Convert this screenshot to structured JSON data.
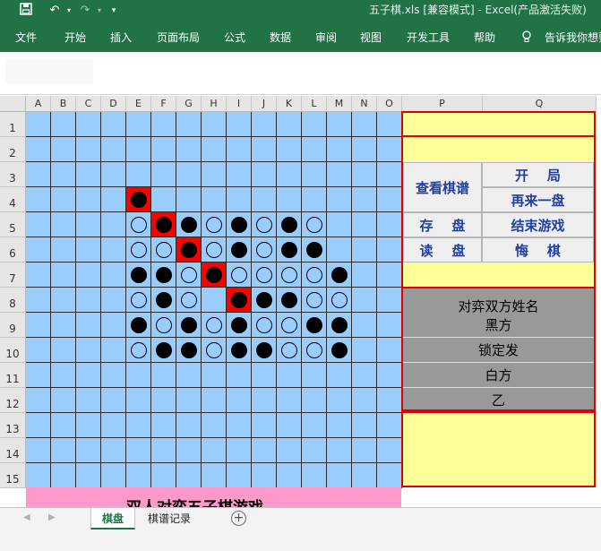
{
  "titlebar": {
    "title": "五子棋.xls  [兼容模式]  -  Excel(产品激活失败)",
    "save_icon": "save-icon",
    "undo_icon": "undo-icon",
    "redo_icon": "redo-icon",
    "customize_icon": "customize-quick-access-icon"
  },
  "ribbon": {
    "tabs": [
      "文件",
      "开始",
      "插入",
      "页面布局",
      "公式",
      "数据",
      "审阅",
      "视图",
      "开发工具",
      "帮助"
    ],
    "tell_me": "告诉我你想要"
  },
  "columns": [
    "A",
    "B",
    "C",
    "D",
    "E",
    "F",
    "G",
    "H",
    "I",
    "J",
    "K",
    "L",
    "M",
    "N",
    "O",
    "P",
    "Q"
  ],
  "rows": [
    "1",
    "2",
    "3",
    "4",
    "5",
    "6",
    "7",
    "8",
    "9",
    "10",
    "11",
    "12",
    "13",
    "14",
    "15"
  ],
  "board": {
    "cell_color": "#99ccff",
    "highlight_color": "#ff0000",
    "stones": [
      {
        "row": 4,
        "col": "E",
        "color": "black",
        "highlight": true
      },
      {
        "row": 5,
        "col": "E",
        "color": "white"
      },
      {
        "row": 5,
        "col": "F",
        "color": "black",
        "highlight": true
      },
      {
        "row": 5,
        "col": "G",
        "color": "black"
      },
      {
        "row": 5,
        "col": "H",
        "color": "white"
      },
      {
        "row": 5,
        "col": "I",
        "color": "black"
      },
      {
        "row": 5,
        "col": "J",
        "color": "white"
      },
      {
        "row": 5,
        "col": "K",
        "color": "black"
      },
      {
        "row": 5,
        "col": "L",
        "color": "white"
      },
      {
        "row": 6,
        "col": "E",
        "color": "white"
      },
      {
        "row": 6,
        "col": "F",
        "color": "white"
      },
      {
        "row": 6,
        "col": "G",
        "color": "black",
        "highlight": true
      },
      {
        "row": 6,
        "col": "H",
        "color": "white"
      },
      {
        "row": 6,
        "col": "I",
        "color": "black"
      },
      {
        "row": 6,
        "col": "J",
        "color": "white"
      },
      {
        "row": 6,
        "col": "K",
        "color": "black"
      },
      {
        "row": 6,
        "col": "L",
        "color": "black"
      },
      {
        "row": 7,
        "col": "E",
        "color": "black"
      },
      {
        "row": 7,
        "col": "F",
        "color": "black"
      },
      {
        "row": 7,
        "col": "G",
        "color": "white"
      },
      {
        "row": 7,
        "col": "H",
        "color": "black",
        "highlight": true
      },
      {
        "row": 7,
        "col": "I",
        "color": "white"
      },
      {
        "row": 7,
        "col": "J",
        "color": "white"
      },
      {
        "row": 7,
        "col": "K",
        "color": "white"
      },
      {
        "row": 7,
        "col": "L",
        "color": "white"
      },
      {
        "row": 7,
        "col": "M",
        "color": "black"
      },
      {
        "row": 8,
        "col": "E",
        "color": "white"
      },
      {
        "row": 8,
        "col": "F",
        "color": "black"
      },
      {
        "row": 8,
        "col": "G",
        "color": "white"
      },
      {
        "row": 8,
        "col": "I",
        "color": "black",
        "highlight": true
      },
      {
        "row": 8,
        "col": "J",
        "color": "black"
      },
      {
        "row": 8,
        "col": "K",
        "color": "black"
      },
      {
        "row": 8,
        "col": "L",
        "color": "white"
      },
      {
        "row": 8,
        "col": "M",
        "color": "white"
      },
      {
        "row": 9,
        "col": "E",
        "color": "black"
      },
      {
        "row": 9,
        "col": "F",
        "color": "white"
      },
      {
        "row": 9,
        "col": "G",
        "color": "black"
      },
      {
        "row": 9,
        "col": "H",
        "color": "white"
      },
      {
        "row": 9,
        "col": "I",
        "color": "black"
      },
      {
        "row": 9,
        "col": "J",
        "color": "white"
      },
      {
        "row": 9,
        "col": "K",
        "color": "white"
      },
      {
        "row": 9,
        "col": "L",
        "color": "black"
      },
      {
        "row": 9,
        "col": "M",
        "color": "black"
      },
      {
        "row": 10,
        "col": "E",
        "color": "white"
      },
      {
        "row": 10,
        "col": "F",
        "color": "black"
      },
      {
        "row": 10,
        "col": "G",
        "color": "black"
      },
      {
        "row": 10,
        "col": "H",
        "color": "white"
      },
      {
        "row": 10,
        "col": "I",
        "color": "black"
      },
      {
        "row": 10,
        "col": "J",
        "color": "black"
      },
      {
        "row": 10,
        "col": "K",
        "color": "white"
      },
      {
        "row": 10,
        "col": "L",
        "color": "white"
      },
      {
        "row": 10,
        "col": "M",
        "color": "black"
      }
    ]
  },
  "side_panel": {
    "buttons": {
      "view_record": "查看棋谱",
      "start": "开    局",
      "restart": "再来一盘",
      "save": "存    盘",
      "end": "结束游戏",
      "load": "读    盘",
      "undo": "悔    棋"
    },
    "players_header": "对弈双方姓名",
    "black_label": "黑方",
    "black_name": "锁定发",
    "white_label": "白方",
    "white_name": "乙"
  },
  "game_title": "双人对弈五子棋游戏",
  "sheet_tabs": [
    "棋盘",
    "棋谱记录"
  ],
  "active_sheet": "棋盘",
  "colors": {
    "excel_green": "#217346",
    "yellow_panel": "#ffff99",
    "grey_panel": "#999999",
    "pink_bar": "#ff99cc",
    "border_red": "#e00000"
  }
}
